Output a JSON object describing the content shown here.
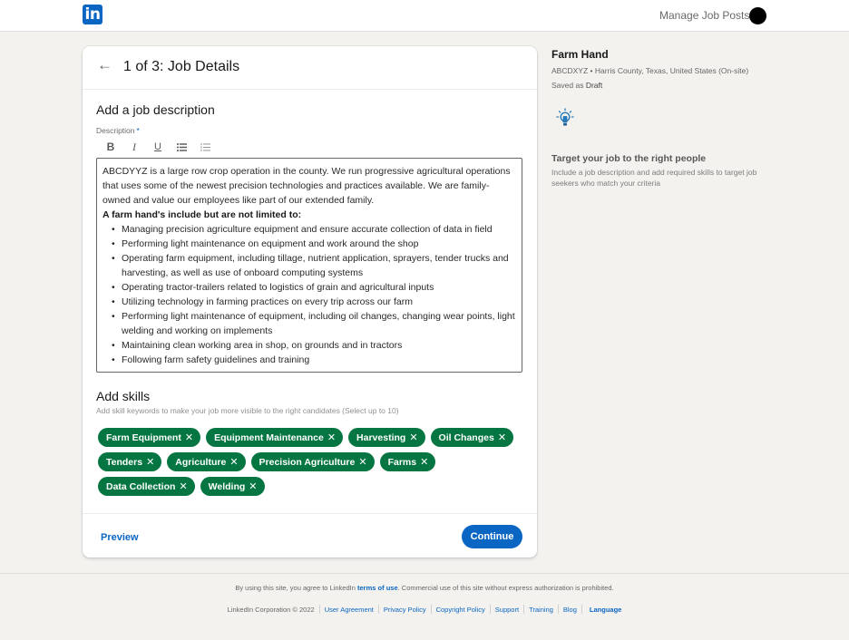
{
  "topbar": {
    "logo_text": "in",
    "manage_link": "Manage Job Posts"
  },
  "card": {
    "step_title": "1 of 3: Job Details",
    "description_section_title": "Add a job description",
    "description_label": "Description",
    "required_marker": "*",
    "toolbar": {
      "bold": "B",
      "italic": "I",
      "underline": "U",
      "bullet_list": "≡",
      "numbered_list": "⁝≡"
    },
    "description": {
      "intro": "ABCDYYZ is a large row crop operation in the county. We run progressive agricultural operations that uses some of the newest precision technologies and practices available. We are family-owned and value our employees like part of our extended family.",
      "list_heading": "A farm hand's include but are not limited to:",
      "bullets": [
        "Managing precision agriculture equipment and ensure accurate collection of data in field",
        "Performing light maintenance on equipment and work around the shop",
        "Operating farm equipment, including tillage, nutrient application, sprayers, tender trucks and harvesting, as well as use of onboard computing systems",
        "Operating tractor-trailers related to logistics of grain and agricultural inputs",
        "Utilizing  technology in farming practices on every trip across our farm",
        "Performing light maintenance of equipment, including oil changes, changing wear points, light welding and working on implements",
        "Maintaining clean working area in shop, on grounds and in tractors",
        "Following farm safety guidelines and training"
      ]
    },
    "skills_section_title": "Add skills",
    "skills_hint": "Add skill keywords to make your job more visible to the right candidates (Select up to 10)",
    "skills": [
      "Farm Equipment",
      "Equipment Maintenance",
      "Harvesting",
      "Oil Changes",
      "Tenders",
      "Agriculture",
      "Precision Agriculture",
      "Farms",
      "Data Collection",
      "Welding"
    ],
    "remove_glyph": "✕",
    "preview_label": "Preview",
    "continue_label": "Continue"
  },
  "side": {
    "job_title": "Farm Hand",
    "company": "ABCDXYZ",
    "meta_sep": "•",
    "location": "Harris County, Texas, United States (On-site)",
    "saved_prefix": "Saved as",
    "saved_status": "Draft",
    "tip_title": "Target your job to the right people",
    "tip_text": "Include a job description and add required skills to target job seekers who match your criteria"
  },
  "footer": {
    "notice_prefix": "By using this site, you agree to LinkedIn",
    "terms_link": "terms of use",
    "notice_suffix": ". Commercial use of this site without express authorization is prohibited.",
    "copyright": "LinkedIn Corporation © 2022",
    "links": [
      "User Agreement",
      "Privacy Policy",
      "Copyright Policy",
      "Support",
      "Training",
      "Blog"
    ],
    "language": "Language"
  },
  "colors": {
    "brand_blue": "#0a66c2",
    "skill_green": "#057642",
    "page_bg": "#f3f2ef"
  }
}
